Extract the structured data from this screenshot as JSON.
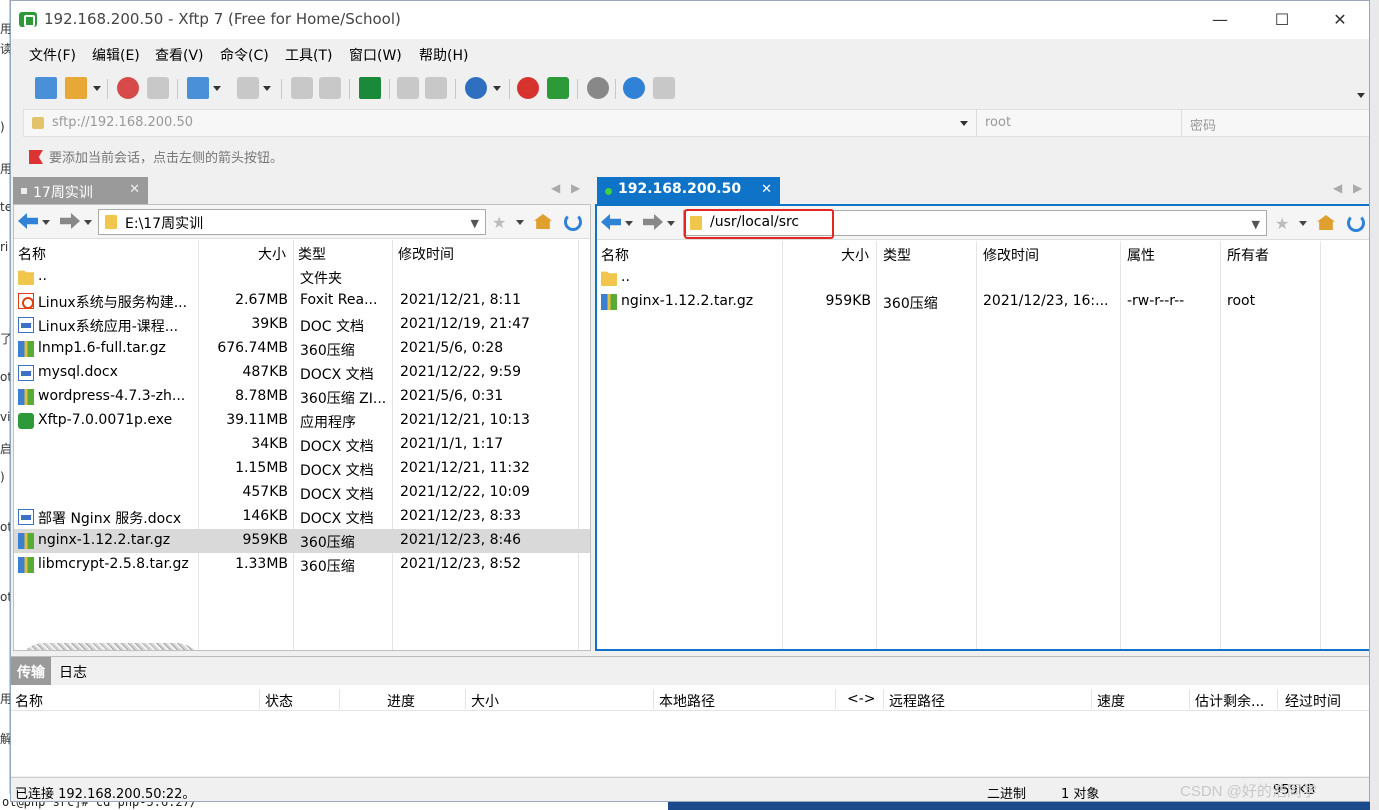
{
  "window": {
    "title": "192.168.200.50 - Xftp 7 (Free for Home/School)"
  },
  "menu": [
    "文件(F)",
    "编辑(E)",
    "查看(V)",
    "命令(C)",
    "工具(T)",
    "窗口(W)",
    "帮助(H)"
  ],
  "address": {
    "url": "sftp://192.168.200.50",
    "username": "root",
    "password_placeholder": "密码"
  },
  "hint": "要添加当前会话，点击左侧的箭头按钮。",
  "left_panel": {
    "tab_label": "17周实训",
    "path": "E:\\17周实训",
    "columns": [
      "名称",
      "大小",
      "类型",
      "修改时间"
    ],
    "rows": [
      {
        "icon": "folder-icon",
        "name": "..",
        "size": "",
        "type": "文件夹",
        "modified": ""
      },
      {
        "icon": "pdf-file-icon",
        "name": "Linux系统与服务构建...",
        "size": "2.67MB",
        "type": "Foxit Rea...",
        "modified": "2021/12/21, 8:11"
      },
      {
        "icon": "word-file-icon",
        "name": "Linux系统应用-课程...",
        "size": "39KB",
        "type": "DOC 文档",
        "modified": "2021/12/19, 21:47"
      },
      {
        "icon": "archive-file-icon",
        "name": "lnmp1.6-full.tar.gz",
        "size": "676.74MB",
        "type": "360压缩",
        "modified": "2021/5/6, 0:28"
      },
      {
        "icon": "word-file-icon",
        "name": "mysql.docx",
        "size": "487KB",
        "type": "DOCX 文档",
        "modified": "2021/12/22, 9:59"
      },
      {
        "icon": "archive-file-icon",
        "name": "wordpress-4.7.3-zh...",
        "size": "8.78MB",
        "type": "360压缩 ZI...",
        "modified": "2021/5/6, 0:31"
      },
      {
        "icon": "exe-file-icon",
        "name": "Xftp-7.0.0071p.exe",
        "size": "39.11MB",
        "type": "应用程序",
        "modified": "2021/12/21, 10:13"
      },
      {
        "icon": "",
        "name": "",
        "size": "34KB",
        "type": "DOCX 文档",
        "modified": "2021/1/1, 1:17"
      },
      {
        "icon": "",
        "name": "",
        "size": "1.15MB",
        "type": "DOCX 文档",
        "modified": "2021/12/21, 11:32"
      },
      {
        "icon": "",
        "name": "",
        "size": "457KB",
        "type": "DOCX 文档",
        "modified": "2021/12/22, 10:09"
      },
      {
        "icon": "word-file-icon",
        "name": "部署 Nginx 服务.docx",
        "size": "146KB",
        "type": "DOCX 文档",
        "modified": "2021/12/23, 8:33"
      },
      {
        "icon": "archive-file-icon",
        "name": "nginx-1.12.2.tar.gz",
        "size": "959KB",
        "type": "360压缩",
        "modified": "2021/12/23, 8:46",
        "selected": true
      },
      {
        "icon": "archive-file-icon",
        "name": "libmcrypt-2.5.8.tar.gz",
        "size": "1.33MB",
        "type": "360压缩",
        "modified": "2021/12/23, 8:52"
      }
    ]
  },
  "right_panel": {
    "tab_label": "192.168.200.50",
    "path": "/usr/local/src",
    "columns": [
      "名称",
      "大小",
      "类型",
      "修改时间",
      "属性",
      "所有者"
    ],
    "rows": [
      {
        "icon": "folder-icon",
        "name": "..",
        "size": "",
        "type": "",
        "modified": "",
        "attr": "",
        "owner": ""
      },
      {
        "icon": "archive-file-icon",
        "name": "nginx-1.12.2.tar.gz",
        "size": "959KB",
        "type": "360压缩",
        "modified": "2021/12/23, 16:...",
        "attr": "-rw-r--r--",
        "owner": "root"
      }
    ]
  },
  "transfer": {
    "tabs": [
      "传输",
      "日志"
    ],
    "columns": [
      "名称",
      "状态",
      "进度",
      "大小",
      "本地路径",
      "<->",
      "远程路径",
      "速度",
      "估计剩余...",
      "经过时间"
    ]
  },
  "status": {
    "connection": "已连接 192.168.200.50:22。",
    "mode": "二进制",
    "count": "1 对象",
    "size": "959KB"
  },
  "watermark": "CSDN @好的浩同学",
  "background": {
    "terminal_line": "ot@php src]# cd php-5.6.27/"
  },
  "colors": {
    "accent": "#0f73c8",
    "highlight_box": "#e3261f",
    "selected_row": "#d9d9d9"
  }
}
